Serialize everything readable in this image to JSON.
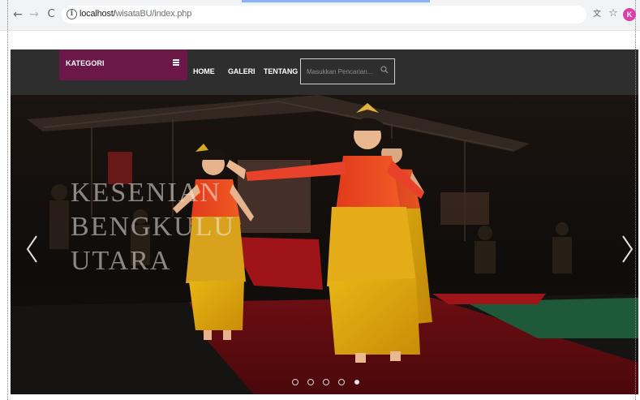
{
  "browser": {
    "url_host": "localhost/",
    "url_path": "wisataBU/index.php",
    "profile_initial": "K",
    "back_glyph": "←",
    "forward_glyph": "→",
    "reload_glyph": "C",
    "translate_glyph": "文",
    "star_glyph": "☆",
    "info_glyph": "i"
  },
  "navbar": {
    "category_label": "KATEGORI",
    "links": [
      "HOME",
      "GALERI",
      "TENTANG"
    ],
    "search": {
      "placeholder": "Masukkan Pencarian..."
    },
    "colors": {
      "background": "#2e2e2e",
      "category_background": "#6b1747"
    }
  },
  "carousel": {
    "caption_lines": [
      "KESENIAN",
      "BENGKULU",
      "UTARA"
    ],
    "prev_icon": "chevron-left-icon",
    "next_icon": "chevron-right-icon",
    "indicator_count": 5,
    "active_indicator": 5
  }
}
